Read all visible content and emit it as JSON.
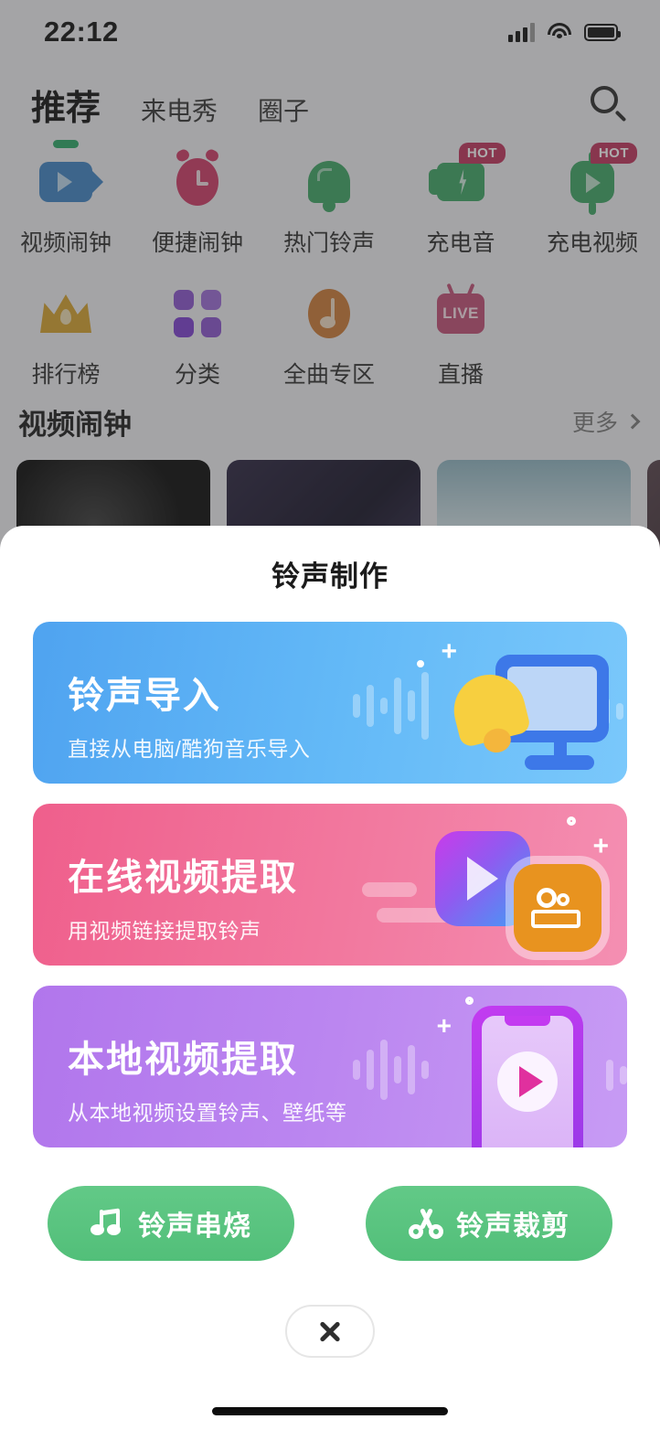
{
  "status_bar": {
    "time": "22:12",
    "signal_icon": "cellular-signal-icon",
    "wifi_icon": "wifi-icon",
    "battery_icon": "battery-full-icon"
  },
  "nav": {
    "tabs": [
      {
        "label": "推荐",
        "active": true
      },
      {
        "label": "来电秀",
        "active": false
      },
      {
        "label": "圈子",
        "active": false
      }
    ],
    "search_icon": "search-icon"
  },
  "grid_menu": {
    "row1": [
      {
        "label": "视频闹钟",
        "icon": "video-alarm-icon",
        "badge": ""
      },
      {
        "label": "便捷闹钟",
        "icon": "alarm-clock-icon",
        "badge": ""
      },
      {
        "label": "热门铃声",
        "icon": "bell-icon",
        "badge": ""
      },
      {
        "label": "充电音",
        "icon": "charging-sound-icon",
        "badge": "HOT"
      },
      {
        "label": "充电视频",
        "icon": "charging-video-icon",
        "badge": "HOT"
      }
    ],
    "row2": [
      {
        "label": "排行榜",
        "icon": "crown-icon",
        "badge": ""
      },
      {
        "label": "分类",
        "icon": "category-grid-icon",
        "badge": ""
      },
      {
        "label": "全曲专区",
        "icon": "music-note-icon",
        "badge": ""
      },
      {
        "label": "直播",
        "icon": "live-tv-icon",
        "badge": ""
      }
    ]
  },
  "section": {
    "title": "视频闹钟",
    "more_label": "更多",
    "more_chevron": "chevron-right-icon"
  },
  "sheet": {
    "title": "铃声制作",
    "cards": [
      {
        "title": "铃声导入",
        "subtitle": "直接从电脑/酷狗音乐导入",
        "color": "#5db0f4",
        "art": "bell-and-monitor-illustration"
      },
      {
        "title": "在线视频提取",
        "subtitle": "用视频链接提取铃声",
        "color": "#f0699a",
        "art": "video-apps-illustration"
      },
      {
        "title": "本地视频提取",
        "subtitle": "从本地视频设置铃声、壁纸等",
        "color": "#b87ff0",
        "art": "phone-play-illustration"
      }
    ],
    "actions": [
      {
        "label": "铃声串烧",
        "icon": "music-notes-icon",
        "color": "#57c282"
      },
      {
        "label": "铃声裁剪",
        "icon": "scissors-icon",
        "color": "#57c282"
      }
    ],
    "close_icon": "close-x-icon"
  }
}
